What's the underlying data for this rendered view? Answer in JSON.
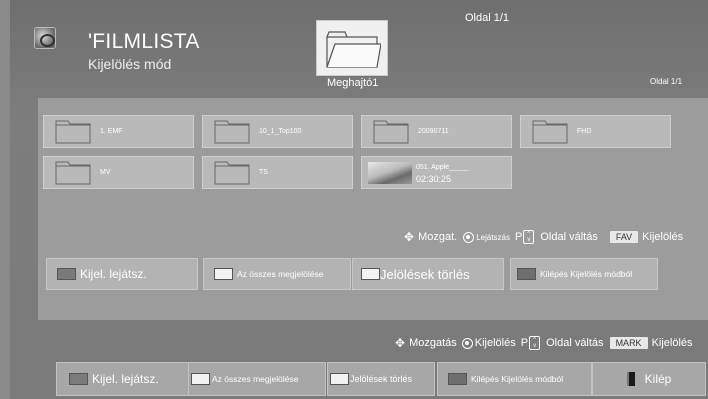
{
  "header": {
    "page_indicator": "Oldal 1/1",
    "title": "'FILMLISTA",
    "mode": "Kijelölés mód",
    "drive_label": "Meghajtó1",
    "page_indicator_right": "Oldal 1/1"
  },
  "files": [
    {
      "name": "1. EMF",
      "type": "folder"
    },
    {
      "name": "10_1_Top100",
      "type": "folder"
    },
    {
      "name": "20090711",
      "type": "folder"
    },
    {
      "name": "FHD",
      "type": "folder"
    },
    {
      "name": "MV",
      "type": "folder"
    },
    {
      "name": "TS",
      "type": "folder"
    },
    {
      "name": "051. Apple_____",
      "time": "02:30:25",
      "type": "video"
    }
  ],
  "inner_hints": {
    "move": "Mozgat.",
    "play": "Lejátszás",
    "p": "P",
    "page_change": "Oldal váltás",
    "fav_key": "FAV",
    "select": "Kijelölés"
  },
  "inner_buttons": [
    {
      "label": "Kijel. lejátsz.",
      "swatch": "#7a7a7a"
    },
    {
      "label": "Az összes megjelölése",
      "swatch": "#f2f2f2"
    },
    {
      "label": "Jelölések törlés",
      "swatch": "#f2f2f2"
    },
    {
      "label": "Kilépés Kijelölés módból",
      "swatch": "#6e6e6e"
    }
  ],
  "bottom_hints": {
    "move": "Mozgatás",
    "select": "Kijelölés",
    "p": "P",
    "page_change": "Oldal váltás",
    "mark_key": "MARK",
    "select2": "Kijelölés"
  },
  "bottom_buttons": [
    {
      "label": "Kijel. lejátsz.",
      "swatch": "#7a7a7a"
    },
    {
      "label": "Az összes megjelölése",
      "swatch": "#f2f2f2"
    },
    {
      "label": "Jelölések törlés",
      "swatch": "#f2f2f2"
    },
    {
      "label": "Kilépés Kijelölés módból",
      "swatch": "#6e6e6e"
    },
    {
      "label": "Kilép"
    }
  ]
}
